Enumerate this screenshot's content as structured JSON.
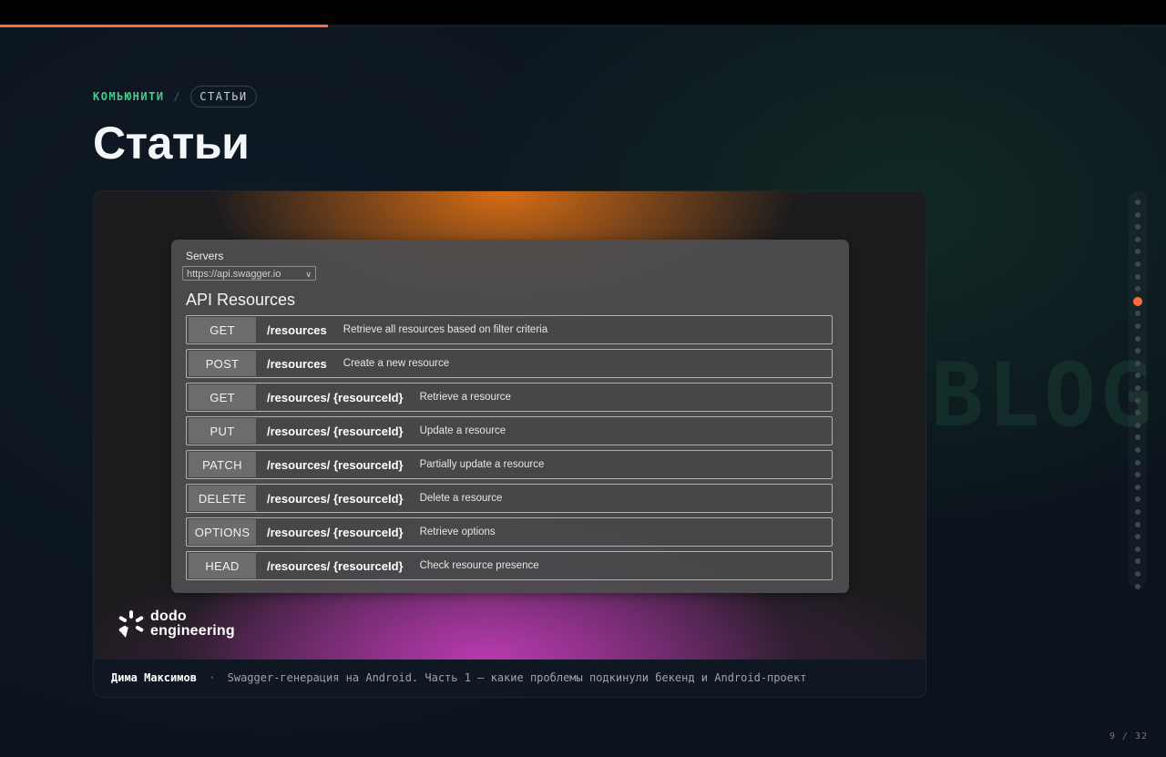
{
  "progress": {
    "value": 0.28125
  },
  "breadcrumb": {
    "community": "КОМЬЮНИТИ",
    "separator": "/",
    "current": "СТАТЬИ"
  },
  "page": {
    "title": "Статьи"
  },
  "card": {
    "servers_label": "Servers",
    "server_url": "https://api.swagger.io",
    "api_heading": "API Resources",
    "endpoints": [
      {
        "method": "GET",
        "path": "/resources",
        "description": "Retrieve all resources based on filter criteria"
      },
      {
        "method": "POST",
        "path": "/resources",
        "description": "Create a new resource"
      },
      {
        "method": "GET",
        "path": "/resources/ {resourceId}",
        "description": "Retrieve a resource"
      },
      {
        "method": "PUT",
        "path": "/resources/ {resourceId}",
        "description": "Update a resource"
      },
      {
        "method": "PATCH",
        "path": "/resources/ {resourceId}",
        "description": "Partially update a resource"
      },
      {
        "method": "DELETE",
        "path": "/resources/ {resourceId}",
        "description": "Delete a resource"
      },
      {
        "method": "OPTIONS",
        "path": "/resources/ {resourceId}",
        "description": "Retrieve options"
      },
      {
        "method": "HEAD",
        "path": "/resources/ {resourceId}",
        "description": "Check resource presence"
      }
    ],
    "logo_line1": "dodo",
    "logo_line2": "engineering",
    "author": "Дима Максимов",
    "separator": "·",
    "article_title": "Swagger-генерация на Android. Часть 1 — какие проблемы подкинули бекенд и Android-проект"
  },
  "watermark": "BLOG",
  "pager": {
    "current": "9",
    "separator": "/",
    "total": "32"
  },
  "colors": {
    "accent": "#ff6a3d",
    "community_green": "#3fd18a"
  }
}
